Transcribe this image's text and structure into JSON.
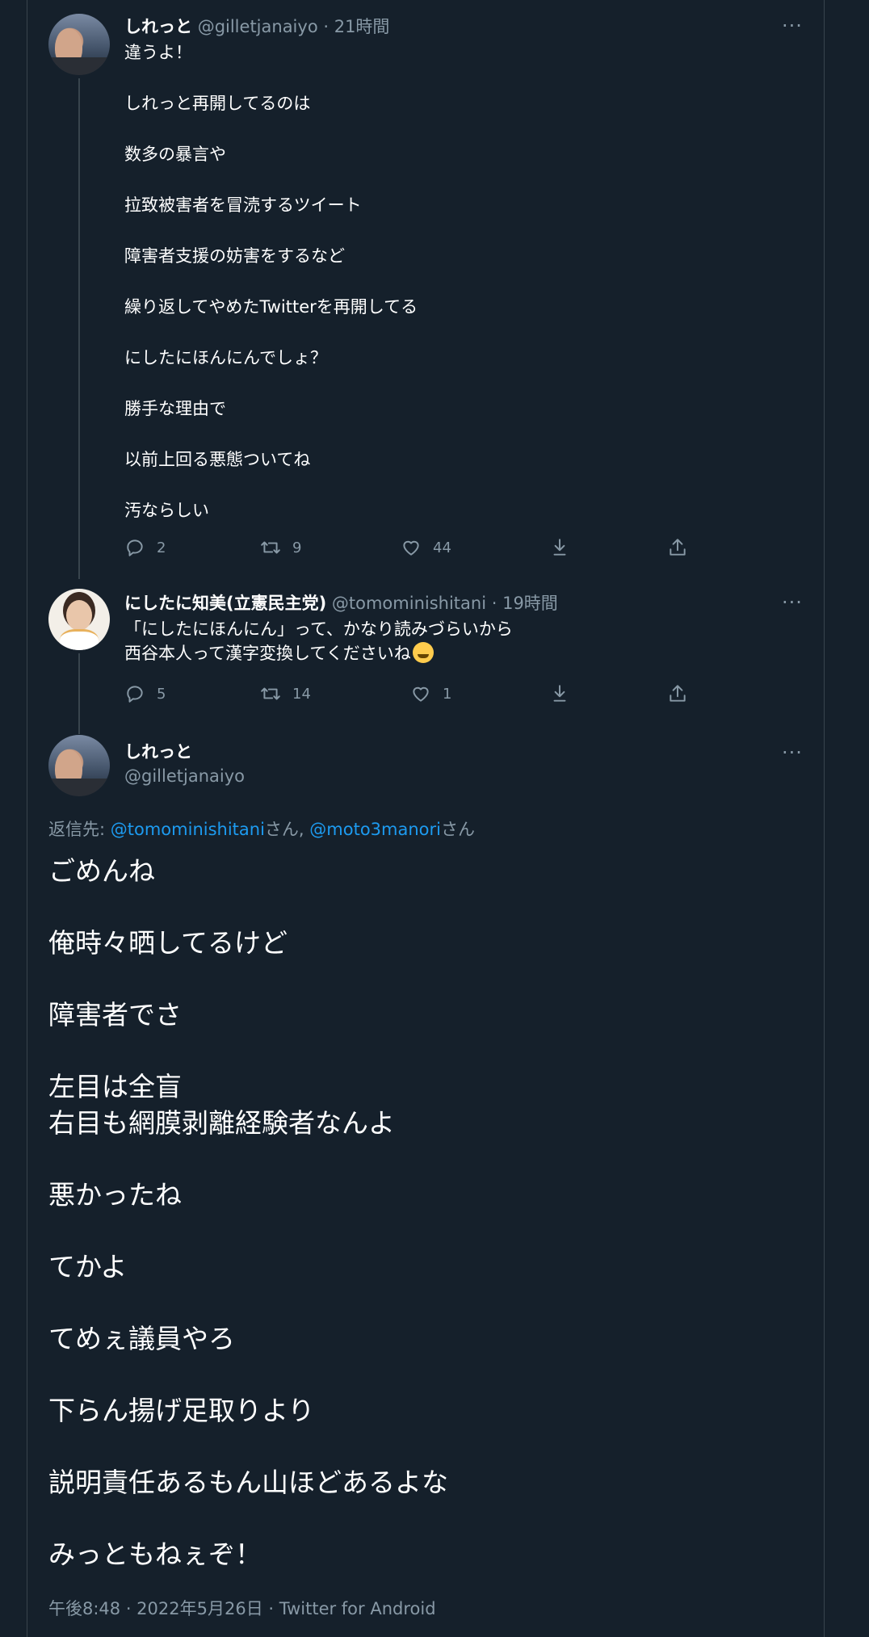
{
  "tweet1": {
    "name": "しれっと",
    "handle": "@gilletjanaiyo",
    "time": "21時間",
    "paragraphs": [
      "違うよ！",
      "しれっと再開してるのは",
      "数多の暴言や",
      "拉致被害者を冒涜するツイート",
      "障害者支援の妨害をするなど",
      "繰り返してやめたTwitterを再開してる",
      "にしたにほんにんでしょ？",
      "勝手な理由で",
      "以前上回る悪態ついてね",
      "汚ならしい"
    ],
    "replies": "2",
    "retweets": "9",
    "likes": "44"
  },
  "tweet2": {
    "name": "にしたに知美(立憲民主党)",
    "handle": "@tomominishitani",
    "time": "19時間",
    "line1": "「にしたにほんにん」って、かなり読みづらいから",
    "line2": "西谷本人って漢字変換してくださいね",
    "emoji": "grinning-sweat-emoji",
    "replies": "5",
    "retweets": "14",
    "likes": "1"
  },
  "main_tweet": {
    "name": "しれっと",
    "handle": "@gilletjanaiyo",
    "replying_prefix": "返信先: ",
    "mention1": "@tomominishitani",
    "suffix1": "さん, ",
    "mention2": "@moto3manori",
    "suffix2": "さん",
    "paragraphs": [
      [
        "ごめんね"
      ],
      [
        "俺時々晒してるけど"
      ],
      [
        "障害者でさ"
      ],
      [
        "左目は全盲",
        "右目も網膜剥離経験者なんよ"
      ],
      [
        "悪かったね"
      ],
      [
        "てかよ"
      ],
      [
        "てめぇ議員やろ"
      ],
      [
        "下らん揚げ足取りより"
      ],
      [
        "説明責任あるもん山ほどあるよな"
      ],
      [
        "みっともねぇぞ！"
      ]
    ],
    "footer": "午後8:48 · 2022年5月26日 · Twitter for Android"
  },
  "common": {
    "separator": " · ",
    "more": "···"
  },
  "colors": {
    "background": "#15202b",
    "border": "#38444d",
    "secondary_text": "#8899a6",
    "link": "#1d9bf0"
  }
}
